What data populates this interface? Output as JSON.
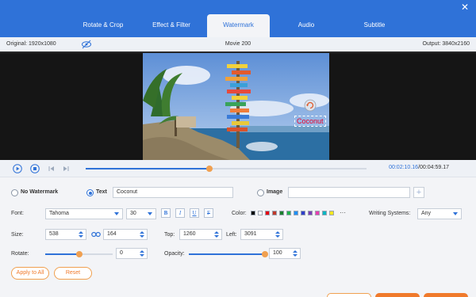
{
  "tabs": [
    {
      "label": "Rotate & Crop"
    },
    {
      "label": "Effect & Filter"
    },
    {
      "label": "Watermark"
    },
    {
      "label": "Audio"
    },
    {
      "label": "Subtitle"
    }
  ],
  "info": {
    "original": "Original: 1920x1080",
    "movie_title": "Movie 200",
    "output": "Output: 3840x2160"
  },
  "preview": {
    "watermark_text": "Coconut"
  },
  "playback": {
    "current_time": "00:02:10.16",
    "separator": "/",
    "total_time": "00:04:59.17",
    "progress": 0.44
  },
  "watermark": {
    "none_label": "No Watermark",
    "text_label": "Text",
    "text_value": "Coconut",
    "image_label": "Image",
    "image_value": "",
    "font_label": "Font:",
    "font_value": "Tahoma",
    "size_value": "30",
    "bold": "B",
    "italic": "I",
    "underline": "U",
    "strike": "F",
    "color_label": "Color:",
    "colors": [
      "#000000",
      "#ffffff",
      "#e60012",
      "#c0392b",
      "#1a7e2c",
      "#22b14c",
      "#1e90ff",
      "#2e3ec9",
      "#7b3fb6",
      "#e83fb0",
      "#00b7c3",
      "#f6e81e"
    ],
    "more_colors": "···",
    "writing_label": "Writing Systems:",
    "writing_value": "Any",
    "size_label": "Size:",
    "width": "538",
    "height": "164",
    "top_label": "Top:",
    "top_value": "1260",
    "left_label": "Left:",
    "left_value": "3091",
    "rotate_label": "Rotate:",
    "rotate_value": "0",
    "rotate_fraction": 0.5,
    "opacity_label": "Opacity:",
    "opacity_value": "100",
    "opacity_fraction": 1.0,
    "apply_all": "Apply to All",
    "reset": "Reset"
  },
  "theme": {
    "accent": "#2f72d8",
    "orange": "#f0a050"
  }
}
